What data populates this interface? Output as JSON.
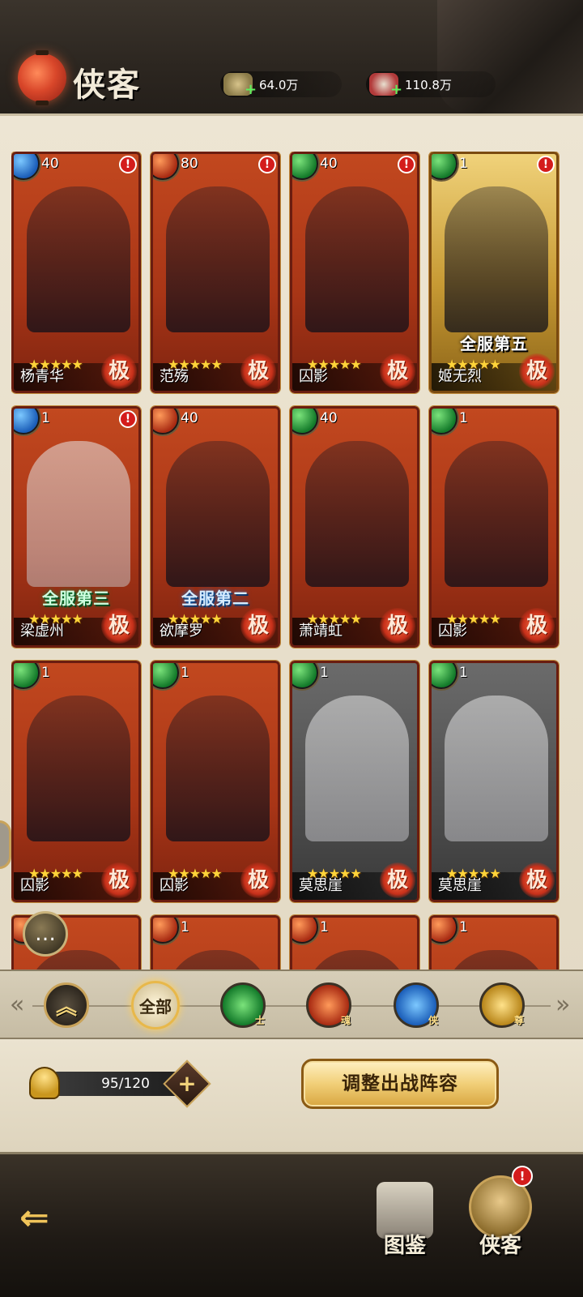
{
  "header": {
    "title": "侠客",
    "currencies": [
      {
        "icon": "silver-ingot-icon",
        "value": "64.0万"
      },
      {
        "icon": "food-plate-icon",
        "value": "110.8万"
      }
    ]
  },
  "heroes": [
    {
      "name": "杨青华",
      "level": "40",
      "faction": "blue",
      "stars": "★★★★★",
      "grade": "极",
      "alert": "!",
      "rank": ""
    },
    {
      "name": "范殇",
      "level": "80",
      "faction": "red",
      "stars": "★★★★★",
      "grade": "极",
      "alert": "!",
      "rank": ""
    },
    {
      "name": "囚影",
      "level": "40",
      "faction": "green",
      "stars": "★★★★★",
      "grade": "极",
      "alert": "!",
      "rank": ""
    },
    {
      "name": "姬无烈",
      "level": "1",
      "faction": "green",
      "stars": "★★★★★",
      "grade": "极",
      "alert": "!",
      "rank": "全服第五"
    },
    {
      "name": "梁虚州",
      "level": "1",
      "faction": "blue",
      "stars": "★★★★★",
      "grade": "极",
      "alert": "!",
      "rank": "全服第三"
    },
    {
      "name": "欲摩罗",
      "level": "40",
      "faction": "red",
      "stars": "★★★★★",
      "grade": "极",
      "alert": "",
      "rank": "全服第二"
    },
    {
      "name": "萧靖虹",
      "level": "40",
      "faction": "green",
      "stars": "★★★★★",
      "grade": "极",
      "alert": "",
      "rank": ""
    },
    {
      "name": "囚影",
      "level": "1",
      "faction": "green",
      "stars": "★★★★★",
      "grade": "极",
      "alert": "",
      "rank": ""
    },
    {
      "name": "囚影",
      "level": "1",
      "faction": "green",
      "stars": "★★★★★",
      "grade": "极",
      "alert": "",
      "rank": ""
    },
    {
      "name": "囚影",
      "level": "1",
      "faction": "green",
      "stars": "★★★★★",
      "grade": "极",
      "alert": "",
      "rank": ""
    },
    {
      "name": "莫思崖",
      "level": "1",
      "faction": "green",
      "stars": "★★★★★",
      "grade": "极",
      "alert": "",
      "rank": ""
    },
    {
      "name": "莫思崖",
      "level": "1",
      "faction": "green",
      "stars": "★★★★★",
      "grade": "极",
      "alert": "",
      "rank": ""
    },
    {
      "name": "",
      "level": "",
      "faction": "red",
      "stars": "",
      "grade": "",
      "alert": "",
      "rank": ""
    },
    {
      "name": "",
      "level": "1",
      "faction": "red",
      "stars": "",
      "grade": "",
      "alert": "",
      "rank": ""
    },
    {
      "name": "",
      "level": "1",
      "faction": "red",
      "stars": "",
      "grade": "",
      "alert": "",
      "rank": ""
    },
    {
      "name": "",
      "level": "1",
      "faction": "red",
      "stars": "",
      "grade": "",
      "alert": "",
      "rank": ""
    }
  ],
  "filters": {
    "sort_icon": "sort-up-icon",
    "all_label": "全部",
    "tags": [
      "士",
      "魂",
      "侠",
      "尊"
    ]
  },
  "footer": {
    "capacity": "95/120",
    "expand_label": "+",
    "lineup_label": "调整出战阵容"
  },
  "nav": {
    "back_icon": "back-arrow-icon",
    "handbook_label": "图鉴",
    "heroes_label": "侠客",
    "alert": "!"
  },
  "chat_icon": "chat-bubble-icon",
  "colors": {
    "accent_gold": "#f1cf78",
    "alert_red": "#d41c1c",
    "card_red": "#b63d1a"
  }
}
